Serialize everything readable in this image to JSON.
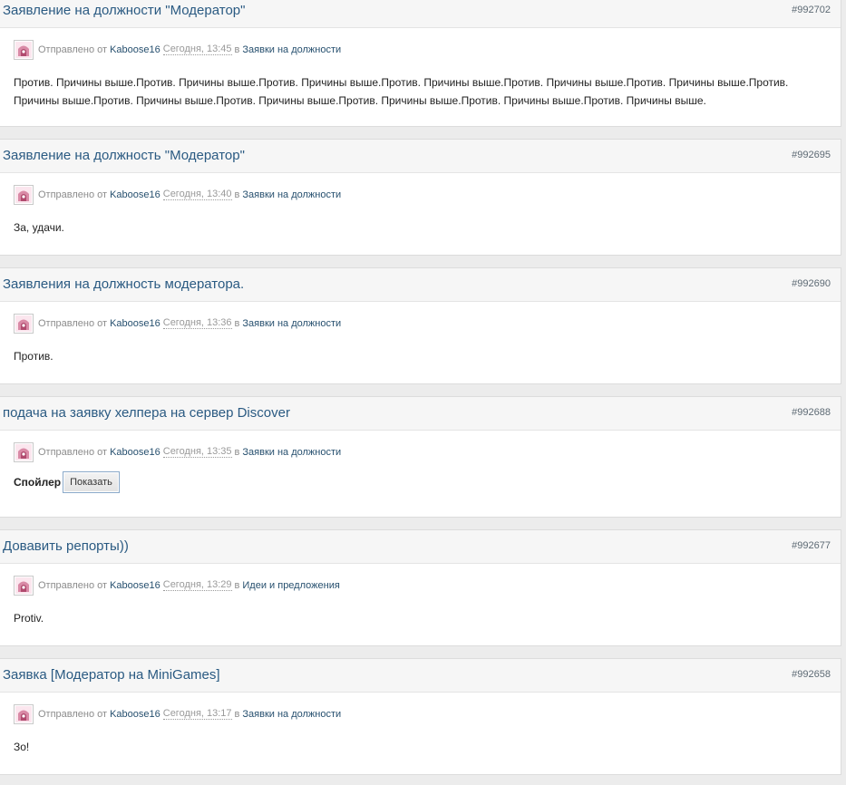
{
  "posts": [
    {
      "title": "Заявление на должности \"Модератор\"",
      "id": "#992702",
      "meta_prefix": "Отправлено от",
      "author": "Kaboose16",
      "date": "Сегодня, 13:45",
      "meta_in": "в",
      "category": "Заявки на должности",
      "content": "Против. Причины выше.Против. Причины выше.Против. Причины выше.Против. Причины выше.Против. Причины выше.Против. Причины выше.Против. Причины выше.Против. Причины выше.Против. Причины выше.Против. Причины выше.Против. Причины выше.Против. Причины выше."
    },
    {
      "title": "Заявление на должность \"Модератор\"",
      "id": "#992695",
      "meta_prefix": "Отправлено от",
      "author": "Kaboose16",
      "date": "Сегодня, 13:40",
      "meta_in": "в",
      "category": "Заявки на должности",
      "content": "За, удачи."
    },
    {
      "title": "Заявления на должность модератора.",
      "id": "#992690",
      "meta_prefix": "Отправлено от",
      "author": "Kaboose16",
      "date": "Сегодня, 13:36",
      "meta_in": "в",
      "category": "Заявки на должности",
      "content": "Против."
    },
    {
      "title": "подача на заявку хелпера на сервер Discover",
      "id": "#992688",
      "meta_prefix": "Отправлено от",
      "author": "Kaboose16",
      "date": "Сегодня, 13:35",
      "meta_in": "в",
      "category": "Заявки на должности",
      "spoiler_label": "Спойлер",
      "spoiler_button": "Показать"
    },
    {
      "title": "Довавить репорты))",
      "id": "#992677",
      "meta_prefix": "Отправлено от",
      "author": "Kaboose16",
      "date": "Сегодня, 13:29",
      "meta_in": "в",
      "category": "Идеи и предложения",
      "content": "Protiv."
    },
    {
      "title": "Заявка [Модератор на MiniGames]",
      "id": "#992658",
      "meta_prefix": "Отправлено от",
      "author": "Kaboose16",
      "date": "Сегодня, 13:17",
      "meta_in": "в",
      "category": "Заявки на должности",
      "content": "Зо!"
    }
  ],
  "icons": {
    "avatar": "user-avatar-icon"
  },
  "colors": {
    "link": "#2a5a82",
    "meta_text": "#8c8c8c",
    "header_bg": "#f6f6f6",
    "page_bg": "#ececec"
  }
}
